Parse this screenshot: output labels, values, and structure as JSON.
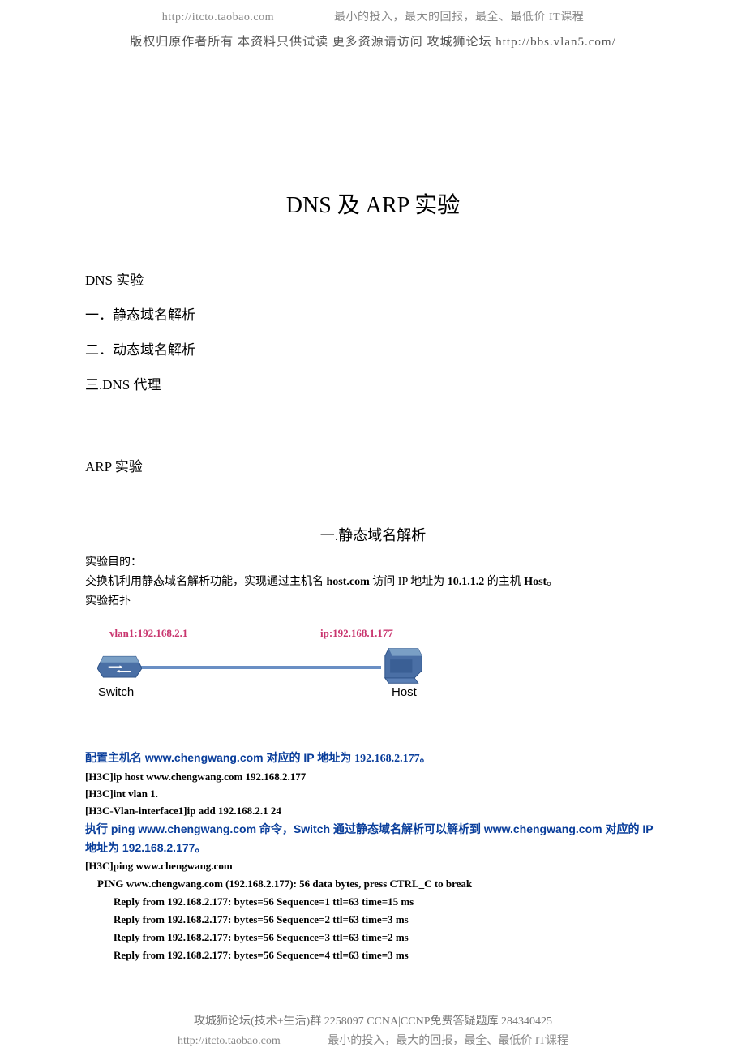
{
  "header": {
    "url": "http://itcto.taobao.com",
    "slogan": "最小的投入，最大的回报，最全、最低价 IT课程",
    "rights": "版权归原作者所有 本资料只供试读 更多资源请访问 攻城狮论坛 http://bbs.vlan5.com/"
  },
  "title": "DNS 及 ARP 实验",
  "toc": {
    "dns_label": "DNS 实验",
    "item1": "一．静态域名解析",
    "item2": "二．动态域名解析",
    "item3": "三.DNS 代理",
    "arp_label": "ARP 实验"
  },
  "section1": {
    "heading": "一.静态域名解析",
    "purpose_label": "实验目的：",
    "purpose_text_1": "交换机利用静态域名解析功能，实现通过主机名 ",
    "purpose_host": "host.com",
    "purpose_text_2": " 访问 IP 地址为 ",
    "purpose_ip": "10.1.1.2",
    "purpose_text_3": " 的主机 ",
    "purpose_hostname": "Host",
    "purpose_text_4": "。",
    "topology_label": "实验拓扑"
  },
  "diagram": {
    "vlan_label": "vlan1:192.168.2.1",
    "ip_label": "ip:192.168.1.177",
    "switch_label": "Switch",
    "host_label": "Host"
  },
  "config": {
    "line1_a": "配置主机名 ",
    "line1_b": "www.chengwang.com",
    "line1_c": " 对应的 IP 地址为 ",
    "line1_d": "192.168.2.177。",
    "cmd1": "[H3C]ip host www.chengwang.com 192.168.2.177",
    "cmd2": "[H3C]int vlan 1.",
    "cmd3": "[H3C-Vlan-interface1]ip add 192.168.2.1 24",
    "line2_a": "执行 ",
    "line2_b": "ping www.chengwang.com",
    "line2_c": " 命令，",
    "line2_d": "Switch",
    "line2_e": " 通过静态域名解析可以解析到 ",
    "line2_f": "www.chengwang.com",
    "line2_g": " 对应的 ",
    "line2_h": "IP",
    "line2_i": " 地址为 ",
    "line2_j": "192.168.2.177",
    "line2_k": "。",
    "cmd4": "[H3C]ping www.chengwang.com",
    "ping_header": "PING www.chengwang.com (192.168.2.177): 56   data bytes, press CTRL_C to break",
    "reply1": "Reply from 192.168.2.177: bytes=56 Sequence=1 ttl=63 time=15 ms",
    "reply2": "Reply from 192.168.2.177: bytes=56 Sequence=2 ttl=63 time=3 ms",
    "reply3": "Reply from 192.168.2.177: bytes=56 Sequence=3 ttl=63 time=2 ms",
    "reply4": "Reply from 192.168.2.177: bytes=56 Sequence=4 ttl=63 time=3 ms"
  },
  "footer": {
    "line1": "攻城狮论坛(技术+生活)群 2258097 CCNA|CCNP免费答疑题库 284340425",
    "url": "http://itcto.taobao.com",
    "slogan": "最小的投入，最大的回报，最全、最低价 IT课程"
  }
}
